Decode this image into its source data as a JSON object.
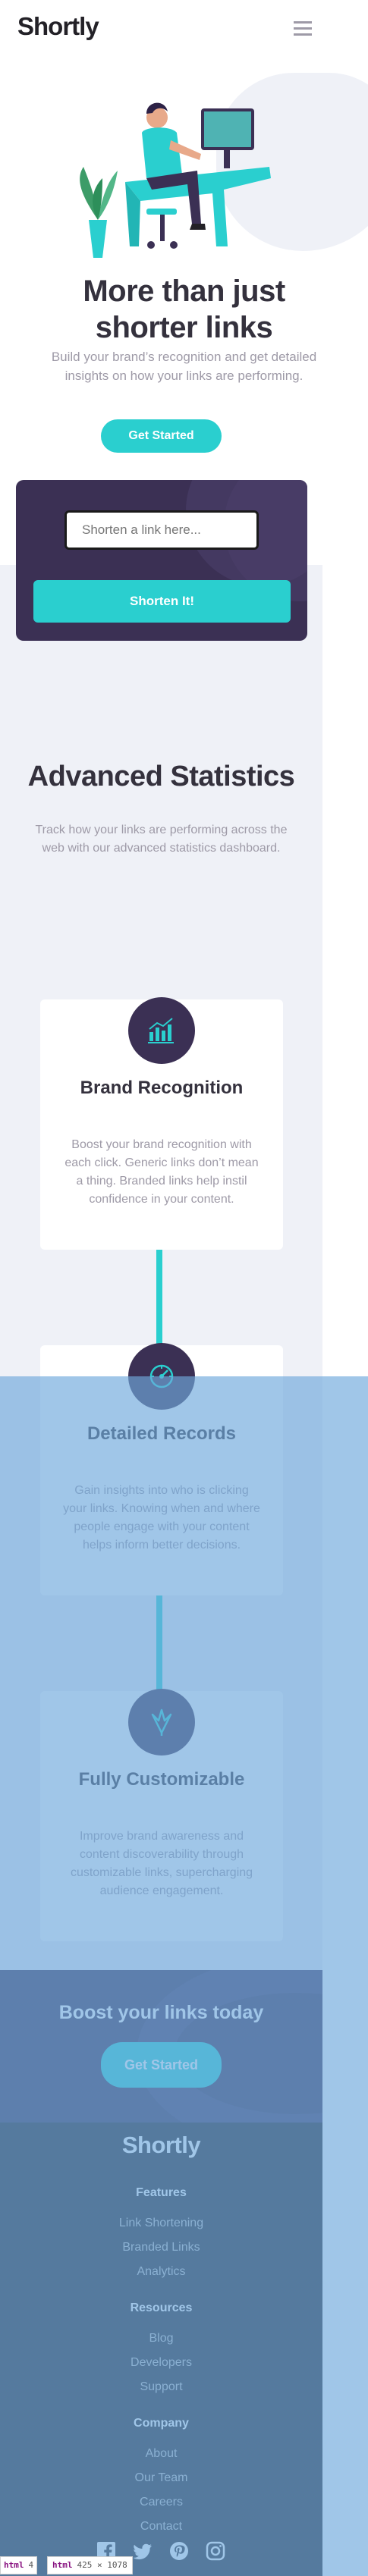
{
  "header": {
    "logo": "Shortly",
    "menu_icon": "hamburger-menu-icon"
  },
  "hero": {
    "title": "More than just shorter links",
    "subtitle": "Build your brand’s recognition and get detailed insights on how your links are performing.",
    "cta_label": "Get Started",
    "illustration": "person-working-illustration"
  },
  "shorten": {
    "placeholder": "Shorten a link here...",
    "button_label": "Shorten It!"
  },
  "stats": {
    "title": "Advanced Statistics",
    "subtitle": "Track how your links are performing across the web with our advanced statistics dashboard.",
    "cards": [
      {
        "icon": "brand-recognition-icon",
        "title": "Brand Recognition",
        "text": "Boost your brand recognition with each click. Generic links don’t mean a thing. Branded links help instil confidence in your content."
      },
      {
        "icon": "detailed-records-icon",
        "title": "Detailed Records",
        "text": "Gain insights into who is clicking your links. Knowing when and where people engage with your content helps inform better decisions."
      },
      {
        "icon": "fully-customizable-icon",
        "title": "Fully Customizable",
        "text": "Improve brand awareness and content discoverability through customizable links, supercharging audience engagement."
      }
    ]
  },
  "boost": {
    "title": "Boost your links today",
    "cta_label": "Get Started"
  },
  "footer": {
    "logo": "Shortly",
    "features": {
      "heading": "Features",
      "links": [
        "Link Shortening",
        "Branded Links",
        "Analytics"
      ]
    },
    "resources": {
      "heading": "Resources",
      "links": [
        "Blog",
        "Developers",
        "Support"
      ]
    },
    "company": {
      "heading": "Company",
      "links": [
        "About",
        "Our Team",
        "Careers",
        "Contact"
      ]
    },
    "social": [
      "facebook-icon",
      "twitter-icon",
      "pinterest-icon",
      "instagram-icon"
    ]
  },
  "devtools": {
    "tag_a": "html",
    "tag_a_dims": "4",
    "tag_b": "html",
    "tag_b_dims": "425 × 1078"
  },
  "colors": {
    "cyan": "#2acfcf",
    "dark_violet": "#3b3054",
    "very_dark": "#232127",
    "gray": "#9e9aa7",
    "highlight": "#6fa8dc"
  }
}
